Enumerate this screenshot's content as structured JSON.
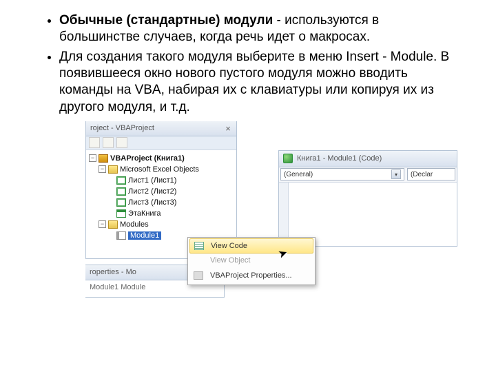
{
  "bullets": {
    "b1_bold": "Обычные (стандартные) модули",
    "b1_rest": " - используются в большинстве случаев, когда речь идет о макросах.",
    "b2": "Для создания такого модуля выберите в меню Insert - Module. В появившееся окно нового пустого модуля можно вводить команды на VBA, набирая их с клавиатуры или копируя их из другого модуля, и т.д."
  },
  "proj": {
    "title": "roject - VBAProject",
    "root": "VBAProject (Книга1)",
    "folder_excel": "Microsoft Excel Objects",
    "sheet1": "Лист1 (Лист1)",
    "sheet2": "Лист2 (Лист2)",
    "sheet3": "Лист3 (Лист3)",
    "thisbook": "ЭтаКнига",
    "folder_modules": "Modules",
    "module1": "Module1"
  },
  "props": {
    "title": "roperties - Mo",
    "row": "Module1  Module"
  },
  "code": {
    "title": "Книга1 - Module1 (Code)",
    "dd_general": "(General)",
    "dd_decl": "(Declar"
  },
  "ctx": {
    "view_code": "View Code",
    "view_object": "View Object",
    "vba_props": "VBAProject Properties..."
  }
}
